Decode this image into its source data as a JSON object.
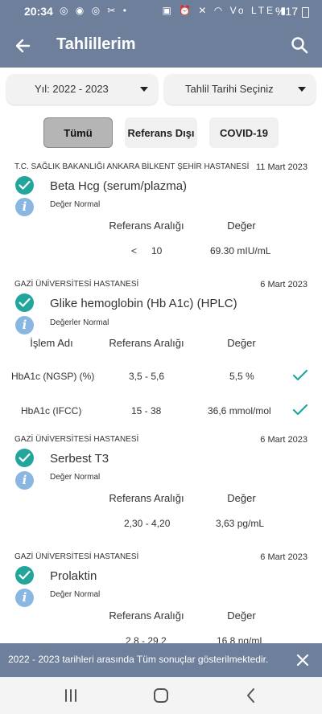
{
  "status_bar": {
    "time": "20:34",
    "left_icons": "◎ ◉ ◎ ✂ •",
    "right_icons": "▣ ⏰ ✕ ◠ Vo LTE ▮",
    "battery": "%17"
  },
  "app_bar": {
    "title": "Tahlillerim",
    "back_icon": "arrow-left-icon",
    "search_icon": "search-icon"
  },
  "filters": {
    "year_select": "Yıl: 2022 - 2023",
    "date_select": "Tahlil Tarihi Seçiniz",
    "buttons": [
      "Tümü",
      "Referans Dışı",
      "COVID-19"
    ],
    "active_button": "Tümü"
  },
  "results": [
    {
      "hospital": "T.C. SAĞLIK BAKANLIĞI ANKARA BİLKENT ŞEHİR HASTANESİ",
      "date": "11 Mart 2023",
      "test_name": "Beta Hcg (serum/plazma)",
      "status": "Değer Normal",
      "col_ref": "Referans Aralığı",
      "col_value": "Değer",
      "row": {
        "ref_op": "<",
        "ref": "10",
        "value": "69.30 mIU/mL"
      }
    },
    {
      "hospital": "GAZİ ÜNİVERSİTESİ HASTANESİ",
      "date": "6 Mart 2023",
      "test_name": "Glike hemoglobin (Hb A1c) (HPLC)",
      "status": "Değerler Normal",
      "col_name": "İşlem Adı",
      "col_ref": "Referans Aralığı",
      "col_value": "Değer",
      "rows": [
        {
          "name": "HbA1c (NGSP) (%)",
          "ref": "3,5 - 5,6",
          "value": "5,5 %"
        },
        {
          "name": "HbA1c (IFCC)",
          "ref": "15 - 38",
          "value": "36,6 mmol/mol"
        }
      ]
    },
    {
      "hospital": "GAZİ ÜNİVERSİTESİ HASTANESİ",
      "date": "6 Mart 2023",
      "test_name": "Serbest T3",
      "status": "Değer Normal",
      "col_ref": "Referans Aralığı",
      "col_value": "Değer",
      "row": {
        "ref": "2,30 - 4,20",
        "value": "3,63 pg/mL"
      }
    },
    {
      "hospital": "GAZİ ÜNİVERSİTESİ HASTANESİ",
      "date": "6 Mart 2023",
      "test_name": "Prolaktin",
      "status": "Değer Normal",
      "col_ref": "Referans Aralığı",
      "col_value": "Değer",
      "row": {
        "ref": "2,8 - 29,2",
        "value": "16,8 ng/mL"
      }
    }
  ],
  "snackbar": {
    "message": "2022 - 2023 tarihleri arasında Tüm sonuçlar gösterilmektedir.",
    "close_icon": "close-icon"
  },
  "nav_bar": {
    "icons": [
      "recent-apps-icon",
      "home-icon",
      "back-icon"
    ]
  },
  "colors": {
    "primary": "#6e7f9c",
    "success": "#22a59a",
    "info": "#8ab6e2"
  }
}
